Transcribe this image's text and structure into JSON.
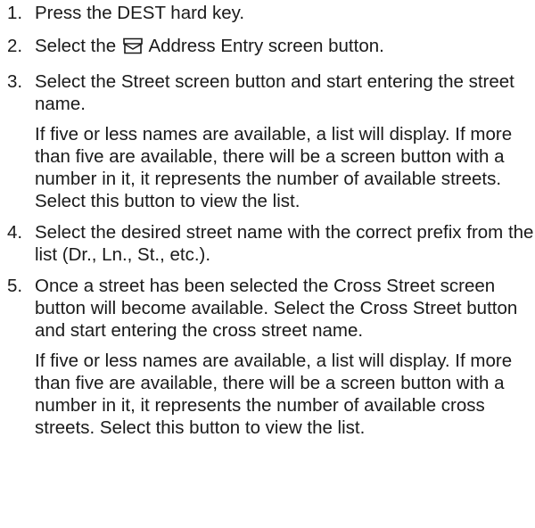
{
  "steps": [
    {
      "number": "1.",
      "text": "Press the DEST hard key."
    },
    {
      "number": "2.",
      "text_before_icon": "Select the",
      "icon": "address-entry-icon",
      "text_after_icon": "Address Entry screen button."
    },
    {
      "number": "3.",
      "text": "Select the Street screen button and start entering the street name.",
      "note": "If five or less names are available, a list will display. If more than five are available, there will be a screen button with a number in it, it represents the number of available streets. Select this button to view the list."
    },
    {
      "number": "4.",
      "text": "Select the desired street name with the correct prefix from the list (Dr., Ln., St., etc.)."
    },
    {
      "number": "5.",
      "text": "Once a street has been selected the Cross Street screen button will become available. Select the Cross Street button and start entering the cross street name.",
      "note": "If five or less names are available, a list will display. If more than five are available, there will be a screen button with a number in it, it represents the number of available cross streets. Select this button to view the list."
    }
  ]
}
